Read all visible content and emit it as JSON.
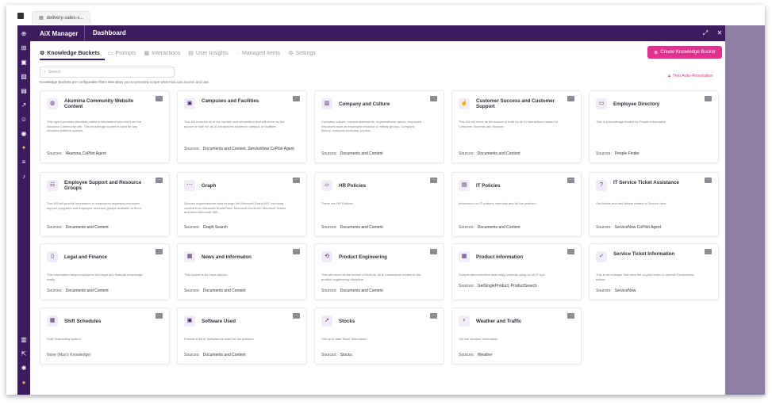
{
  "browser": {
    "tab_title": "delivery-sales-s..."
  },
  "header": {
    "app_name": "AiX Manager",
    "section": "Dashboard"
  },
  "nav_tabs": [
    {
      "label": "Knowledge Buckets",
      "icon": "gear-icon",
      "active": true
    },
    {
      "label": "Prompts",
      "icon": "prompt-icon",
      "active": false
    },
    {
      "label": "Interactions",
      "icon": "grid-icon",
      "active": false
    },
    {
      "label": "User Insights",
      "icon": "insights-icon",
      "active": false
    },
    {
      "label": "Managed Items",
      "icon": "chat-icon",
      "active": false
    },
    {
      "label": "Settings",
      "icon": "gear-icon",
      "active": false
    }
  ],
  "create_button": "Create Knowledge Bucket",
  "search": {
    "placeholder": "Search"
  },
  "helper_text": "Knowledge Buckets are configurable filters that allow you to precisely scope what Aiva can access and use.",
  "auto_resolution": "Test Auto-Resolution",
  "sources_label": "Sources:",
  "cards": [
    {
      "title": "Akumina Community Website Content",
      "icon": "globe-icon",
      "desc": "This agent provides Akumina platform information sourced from the Akumina Community site. This knowledge bucket is used for any Akumina platform queries.",
      "sources": "Akumina CoPilot Agent"
    },
    {
      "title": "Campuses and Facilities",
      "icon": "camera-icon",
      "desc": "This KB includes all of the content and information that will serve as the source of truth for all AI interactions related to campus or facilities.",
      "sources": "Documents and Content, ServiceNow CoPilot Agent"
    },
    {
      "title": "Company and Culture",
      "icon": "building-icon",
      "desc": "Company culture, mission statements, organizational values, employee resources such as employee resource or affinity groups, Company history, company evolution, produc...",
      "sources": "Documents and Content"
    },
    {
      "title": "Customer Success and Customer Support",
      "icon": "thumbs-up-icon",
      "desc": "This KB will serve as the source of truth for all AI interactions related to Customer Success and Support.",
      "sources": "Documents and Content"
    },
    {
      "title": "Employee Directory",
      "icon": "id-card-icon",
      "desc": "This is a knowledge bucket for People information",
      "sources": "People Finder"
    },
    {
      "title": "Employee Support and Resource Groups",
      "icon": "people-icon",
      "desc": "This KB will provide information to employees regarding employee support programs and employee resource groups available to them.",
      "sources": "Documents and Content"
    },
    {
      "title": "Graph",
      "icon": "graph-icon",
      "desc": "Queries organizational data through the Microsoft Graph API, including content from Microsoft SharePoint, Microsoft OneDrive, Microsoft Teams, and other Microsoft 365...",
      "sources": "Graph Search"
    },
    {
      "title": "HR Policies",
      "icon": "folder-icon",
      "desc": "These are HR Policies",
      "sources": "Documents and Content"
    },
    {
      "title": "IT Policies",
      "icon": "document-icon",
      "desc": "Information on IT policies internally and for the platform",
      "sources": "Documents and Content"
    },
    {
      "title": "IT Service Ticket Assistance",
      "icon": "question-icon",
      "desc": "Get tickets and add tickets related to Service Now",
      "sources": "ServiceNow CoPilot Agent"
    },
    {
      "title": "Legal and Finance",
      "icon": "file-icon",
      "desc": "This information helps employees find legal and financial knowledge easily",
      "sources": "Documents and Content"
    },
    {
      "title": "News and Informaton",
      "icon": "news-icon",
      "desc": "This bucket is for news articles",
      "sources": "Documents and Content"
    },
    {
      "title": "Product Engineering",
      "icon": "engineering-icon",
      "desc": "This will serve as the source of truth for all AI interactions related to the product engineering discipline.",
      "sources": "Documents and Content"
    },
    {
      "title": "Product Information",
      "icon": "table-icon",
      "desc": "Sample demonstrative searching products using an MCP tool",
      "sources": "GetSingleProduct, ProductSearch"
    },
    {
      "title": "Service Ticket Information",
      "icon": "ticket-icon",
      "desc": "This is an example that uses the co-pilot index to retrieve ServiceNow tickets",
      "sources": "ServiceNow"
    },
    {
      "title": "Shift Schedules",
      "icon": "calendar-icon",
      "desc": "Shift Scheduling system",
      "sources_full": "None (Max's Knowledge)"
    },
    {
      "title": "Software Used",
      "icon": "software-icon",
      "desc": "Provide a list of Software be used for the platform.",
      "sources": "Documents and Content"
    },
    {
      "title": "Stocks",
      "icon": "trend-icon",
      "desc": "Get up to date Stock Information",
      "sources": "Stocks"
    },
    {
      "title": "Weather and Traffic",
      "icon": "lightbulb-icon",
      "desc": "Get the weather information",
      "sources": "Weather"
    }
  ]
}
